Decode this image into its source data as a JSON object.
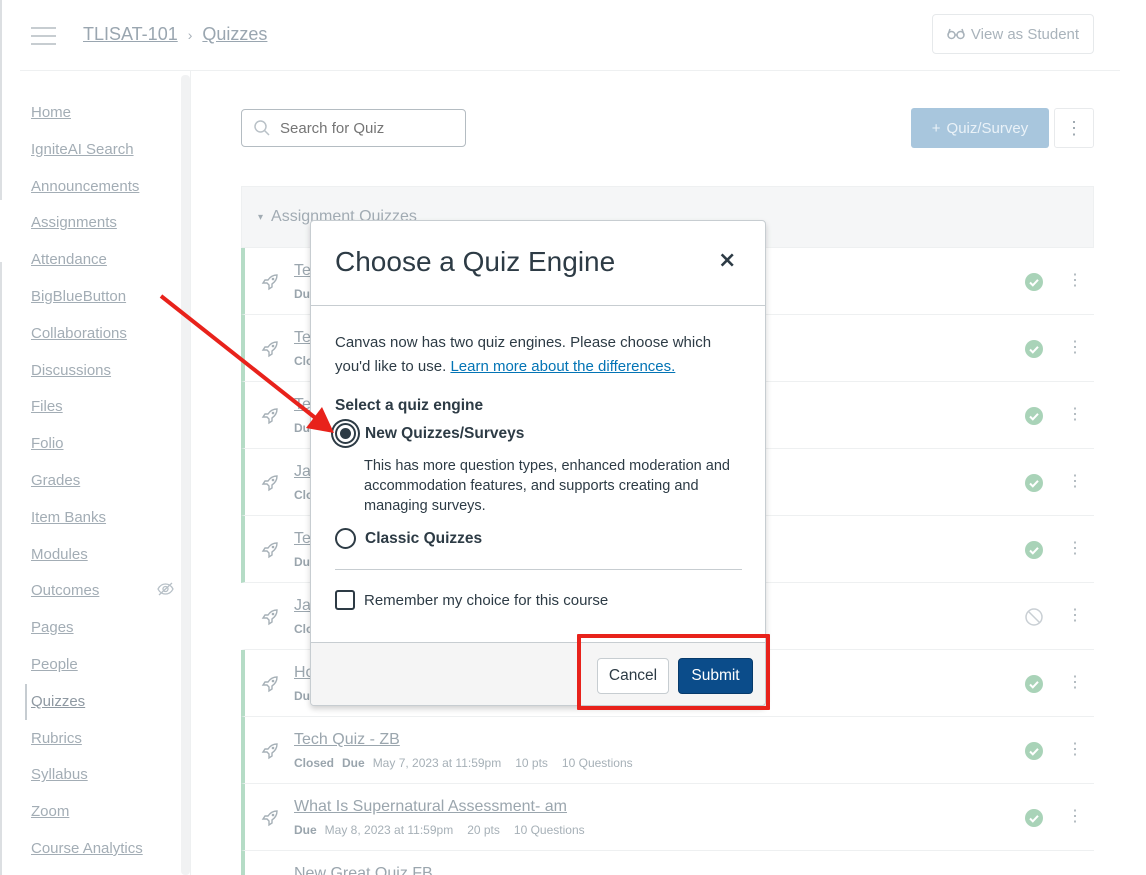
{
  "header": {
    "breadcrumb": [
      "TLISAT-101",
      "Quizzes"
    ],
    "breadcrumb_sep": "›",
    "view_as_student": "View as Student"
  },
  "nav": {
    "items": [
      {
        "label": "Home"
      },
      {
        "label": "IgniteAI Search"
      },
      {
        "label": "Announcements"
      },
      {
        "label": "Assignments"
      },
      {
        "label": "Attendance"
      },
      {
        "label": "BigBlueButton"
      },
      {
        "label": "Collaborations"
      },
      {
        "label": "Discussions"
      },
      {
        "label": "Files"
      },
      {
        "label": "Folio"
      },
      {
        "label": "Grades"
      },
      {
        "label": "Item Banks"
      },
      {
        "label": "Modules"
      },
      {
        "label": "Outcomes"
      },
      {
        "label": "Pages"
      },
      {
        "label": "People"
      },
      {
        "label": "Quizzes",
        "active": true
      },
      {
        "label": "Rubrics"
      },
      {
        "label": "Syllabus"
      },
      {
        "label": "Zoom"
      },
      {
        "label": "Course Analytics"
      }
    ]
  },
  "toolbar": {
    "search_placeholder": "Search for Quiz",
    "add_quiz_label": "Quiz/Survey",
    "add_quiz_icon": "+"
  },
  "group": {
    "title": "Assignment Quizzes",
    "toggle": "▾"
  },
  "quizzes": [
    {
      "title": "Te",
      "state": "Du",
      "published": true
    },
    {
      "title": "Te",
      "state": "Clo",
      "published": true
    },
    {
      "title": "Te",
      "state": "Du",
      "published": true
    },
    {
      "title": "Ja",
      "state": "Clo",
      "published": true
    },
    {
      "title": "Te",
      "state": "Du",
      "published": true
    },
    {
      "title": "Ja",
      "state": "Clo",
      "published": false
    },
    {
      "title": "Ho",
      "state": "Du",
      "published": true
    },
    {
      "title": "Tech Quiz - ZB",
      "state": "Closed",
      "due_label": "Due",
      "due": "May 7, 2023 at 11:59pm",
      "pts": "10 pts",
      "questions": "10 Questions",
      "published": true
    },
    {
      "title": "What Is Supernatural Assessment- am",
      "state": "Due",
      "due_label": "",
      "due": "May 8, 2023 at 11:59pm",
      "pts": "20 pts",
      "questions": "10 Questions",
      "published": true
    },
    {
      "title": "New Great Quiz FB",
      "state": "",
      "published": true
    }
  ],
  "modal": {
    "title": "Choose a Quiz Engine",
    "close": "×",
    "intro": "Canvas now has two quiz engines. Please choose which you'd like to use.",
    "learn_more": "Learn more about the differences.",
    "legend": "Select a quiz engine",
    "option_new": "New Quizzes/Surveys",
    "option_new_desc": "This has more question types, enhanced moderation and accommodation features, and supports creating and managing surveys.",
    "option_classic": "Classic Quizzes",
    "selected": "new",
    "remember": "Remember my choice for this course",
    "cancel": "Cancel",
    "submit": "Submit"
  },
  "colors": {
    "annotation": "#e8221b",
    "submit_bg": "#0b4c8a",
    "published_green": "#b5dcc6"
  }
}
